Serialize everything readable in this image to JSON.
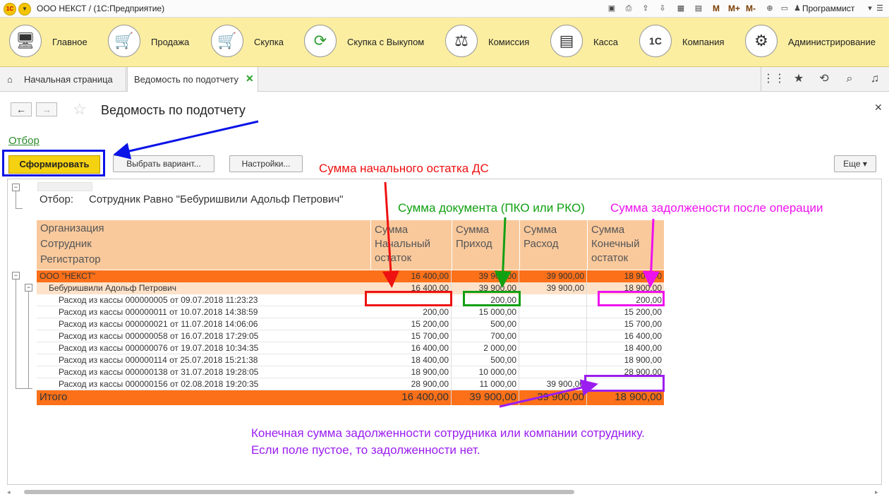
{
  "titlebar": {
    "logo": "1С",
    "title": "ООО НЕКСТ /  (1С:Предприятие)",
    "m1": "M",
    "m2": "M+",
    "m3": "M-",
    "user": "Программист"
  },
  "sections": [
    {
      "label": "Главное",
      "icon": "computer-icon"
    },
    {
      "label": "Продажа",
      "icon": "cart-up-icon"
    },
    {
      "label": "Скупка",
      "icon": "cart-down-icon"
    },
    {
      "label": "Скупка с Выкупом",
      "icon": "cycle-icon"
    },
    {
      "label": "Комиссия",
      "icon": "scales-icon"
    },
    {
      "label": "Касса",
      "icon": "cash-register-icon"
    },
    {
      "label": "Компания",
      "icon": "company-logo-icon"
    },
    {
      "label": "Администрирование",
      "icon": "gears-icon"
    }
  ],
  "tabs": {
    "home": "Начальная страница",
    "active": "Ведомость по подотчету"
  },
  "form": {
    "title": "Ведомость по подотчету",
    "otbor_link": "Отбор",
    "btn_generate": "Сформировать",
    "btn_variant": "Выбрать вариант...",
    "btn_settings": "Настройки...",
    "btn_more": "Еще"
  },
  "report": {
    "filter_label": "Отбор:",
    "filter_value": "Сотрудник Равно \"Бебуришвили Адольф Петрович\"",
    "headers": {
      "group1": "Организация",
      "group2": "Сотрудник",
      "group3": "Регистратор",
      "c1": "Сумма Начальный остаток",
      "c2": "Сумма Приход",
      "c3": "Сумма Расход",
      "c4": "Сумма Конечный остаток"
    },
    "org": {
      "name": "ООО \"НЕКСТ\"",
      "c1": "16 400,00",
      "c2": "39 900,00",
      "c3": "39 900,00",
      "c4": "18 900,00"
    },
    "employee": {
      "name": "Бебуришвили Адольф Петрович",
      "c1": "16 400,00",
      "c2": "39 900,00",
      "c3": "39 900,00",
      "c4": "18 900,00"
    },
    "rows": [
      {
        "name": "Расход из кассы 000000005 от 09.07.2018 11:23:23",
        "c1": "",
        "c2": "200,00",
        "c3": "",
        "c4": "200,00"
      },
      {
        "name": "Расход из кассы 000000011 от 10.07.2018 14:38:59",
        "c1": "200,00",
        "c2": "15 000,00",
        "c3": "",
        "c4": "15 200,00"
      },
      {
        "name": "Расход из кассы 000000021 от 11.07.2018 14:06:06",
        "c1": "15 200,00",
        "c2": "500,00",
        "c3": "",
        "c4": "15 700,00"
      },
      {
        "name": "Расход из кассы 000000058 от 16.07.2018 17:29:05",
        "c1": "15 700,00",
        "c2": "700,00",
        "c3": "",
        "c4": "16 400,00"
      },
      {
        "name": "Расход из кассы 000000076 от 19.07.2018 10:34:35",
        "c1": "16 400,00",
        "c2": "2 000,00",
        "c3": "",
        "c4": "18 400,00"
      },
      {
        "name": "Расход из кассы 000000114 от 25.07.2018 15:21:38",
        "c1": "18 400,00",
        "c2": "500,00",
        "c3": "",
        "c4": "18 900,00"
      },
      {
        "name": "Расход из кассы 000000138 от 31.07.2018 19:28:05",
        "c1": "18 900,00",
        "c2": "10 000,00",
        "c3": "",
        "c4": "28 900,00"
      },
      {
        "name": "Расход из кассы 000000156 от 02.08.2018 19:20:35",
        "c1": "28 900,00",
        "c2": "11 000,00",
        "c3": "39 900,00",
        "c4": ""
      }
    ],
    "total": {
      "name": "Итого",
      "c1": "16 400,00",
      "c2": "39 900,00",
      "c3": "39 900,00",
      "c4": "18 900,00"
    }
  },
  "annotations": {
    "start": "Сумма начального остатка ДС",
    "doc": "Сумма документа (ПКО или РКО)",
    "debt": "Сумма задолжености после операции",
    "final_line1": "Конечная сумма задолженности сотрудника или компании сотруднику.",
    "final_line2": "Если поле пустое, то задолженности нет.",
    "colors": {
      "red": "#ee1111",
      "green": "#11a011",
      "magenta": "#ee11ee",
      "purple": "#9b1df0",
      "blue": "#0a14e6"
    }
  }
}
